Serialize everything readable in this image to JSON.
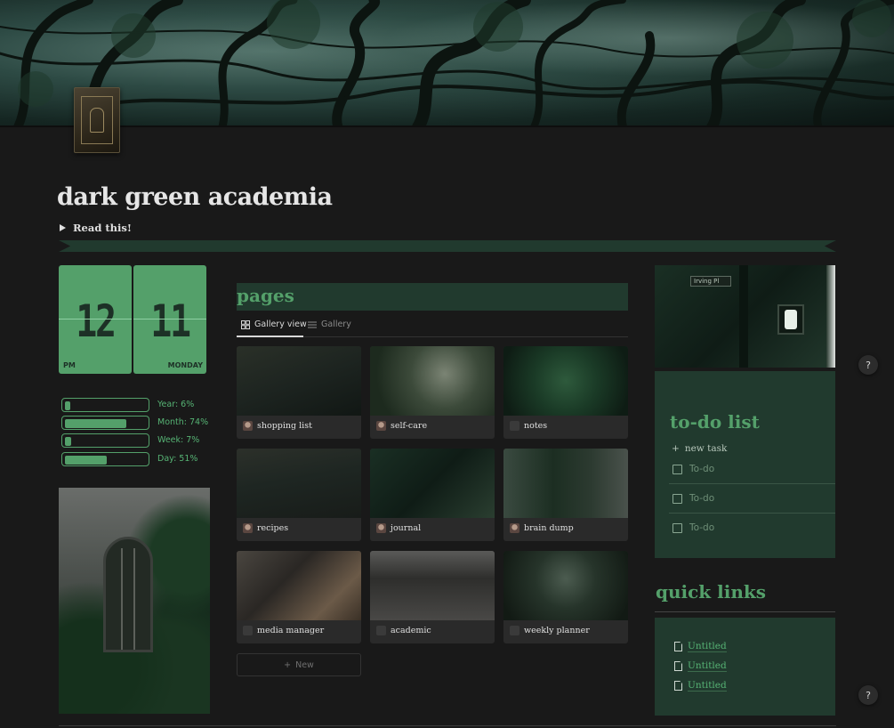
{
  "page": {
    "title": "dark green academia",
    "toggle_label": "Read this!"
  },
  "clock": {
    "hour": "12",
    "minute": "11",
    "period": "PM",
    "day": "MONDAY"
  },
  "progress": [
    {
      "label": "Year: 6%",
      "fraction": 0.06
    },
    {
      "label": "Month: 74%",
      "fraction": 0.74
    },
    {
      "label": "Week: 7%",
      "fraction": 0.07
    },
    {
      "label": "Day: 51%",
      "fraction": 0.51
    }
  ],
  "pages": {
    "heading": "pages",
    "views": [
      "Gallery view",
      "Gallery"
    ],
    "cards": [
      "shopping list",
      "self-care",
      "notes",
      "recipes",
      "journal",
      "brain dump",
      "media manager",
      "academic",
      "weekly planner"
    ],
    "new_label": "New"
  },
  "street_sign": "Irving Pl",
  "todo": {
    "heading": "to-do list",
    "new_task": "new task",
    "items": [
      "To-do",
      "To-do",
      "To-do"
    ]
  },
  "quick_links": {
    "heading": "quick links",
    "links": [
      "Untitled",
      "Untitled",
      "Untitled"
    ]
  },
  "help_label": "?"
}
